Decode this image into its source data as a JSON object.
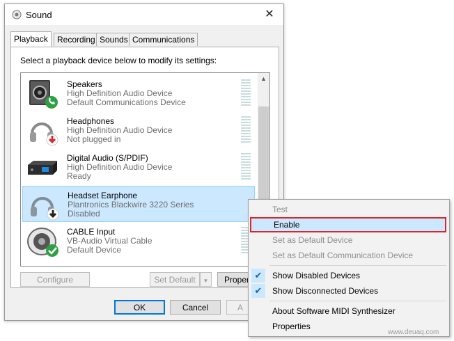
{
  "window": {
    "title": "Sound",
    "close_symbol": "✕"
  },
  "tabs": [
    {
      "label": "Playback"
    },
    {
      "label": "Recording"
    },
    {
      "label": "Sounds"
    },
    {
      "label": "Communications"
    }
  ],
  "playback": {
    "instruction": "Select a playback device below to modify its settings:",
    "devices": [
      {
        "name": "Speakers",
        "description": "High Definition Audio Device",
        "state": "Default Communications Device",
        "icon": "speaker-icon",
        "badge": "phone-badge-icon"
      },
      {
        "name": "Headphones",
        "description": "High Definition Audio Device",
        "state": "Not plugged in",
        "icon": "headphones-icon",
        "badge": "red-down-arrow-badge-icon"
      },
      {
        "name": "Digital Audio (S/PDIF)",
        "description": "High Definition Audio Device",
        "state": "Ready",
        "icon": "digital-audio-icon",
        "badge": ""
      },
      {
        "name": "Headset Earphone",
        "description": "Plantronics Blackwire 3220 Series",
        "state": "Disabled",
        "icon": "headset-icon",
        "badge": "black-down-arrow-badge-icon",
        "selected": true
      },
      {
        "name": "CABLE Input",
        "description": "VB-Audio Virtual Cable",
        "state": "Default Device",
        "icon": "cable-speaker-icon",
        "badge": "green-check-badge-icon"
      }
    ]
  },
  "buttons": {
    "configure": "Configure",
    "set_default": "Set Default",
    "properties": "Proper",
    "ok": "OK",
    "cancel": "Cancel",
    "apply": "A"
  },
  "context_menu": {
    "items": [
      {
        "label": "Test",
        "disabled": true
      },
      {
        "label": "Enable",
        "highlighted": true
      },
      {
        "label": "Set as Default Device",
        "disabled": true
      },
      {
        "label": "Set as Default Communication Device",
        "disabled": true
      },
      {
        "label": "Show Disabled Devices",
        "checked": true
      },
      {
        "label": "Show Disconnected Devices",
        "checked": true
      },
      {
        "label": "About Software MIDI Synthesizer"
      },
      {
        "label": "Properties"
      }
    ],
    "check_symbol": "✔"
  },
  "watermark": "www.deuaq.com"
}
